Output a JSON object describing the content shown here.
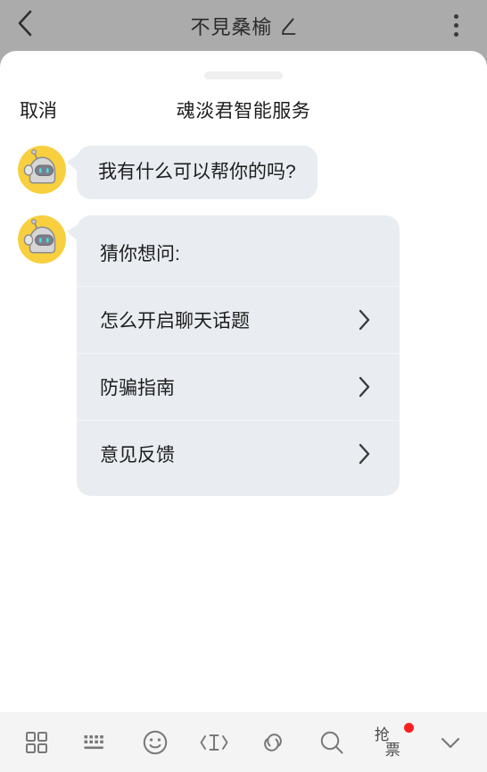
{
  "topbar": {
    "back_icon": "chevron-left-icon",
    "title": "不見桑榆",
    "edit_icon": "pencil-edit-icon",
    "more_icon": "more-vertical-icon"
  },
  "sheet": {
    "grabber": "drag-handle",
    "cancel_label": "取消",
    "title": "魂淡君智能服务"
  },
  "chat": {
    "messages": [
      {
        "avatar": "robot-avatar",
        "text": "我有什么可以帮你的吗?"
      }
    ],
    "card": {
      "avatar": "robot-avatar",
      "title": "猜你想问:",
      "items": [
        {
          "label": "怎么开启聊天话题",
          "chevron": "chevron-right-icon"
        },
        {
          "label": "防骗指南",
          "chevron": "chevron-right-icon"
        },
        {
          "label": "意见反馈",
          "chevron": "chevron-right-icon"
        }
      ]
    }
  },
  "toolbar": {
    "items": [
      {
        "icon": "grid-apps-icon",
        "label": ""
      },
      {
        "icon": "keyboard-icon",
        "label": ""
      },
      {
        "icon": "emoji-smiley-icon",
        "label": ""
      },
      {
        "icon": "text-cursor-icon",
        "label": ""
      },
      {
        "icon": "link-chain-icon",
        "label": ""
      },
      {
        "icon": "search-icon",
        "label": ""
      }
    ],
    "ticket": {
      "icon": "grab-ticket-icon",
      "char1": "抢",
      "char2": "票",
      "badge": "red-dot"
    },
    "collapse": {
      "icon": "chevron-down-icon"
    }
  },
  "colors": {
    "header_bg": "#ababab",
    "sheet_bg": "#ffffff",
    "bubble_bg": "#e9edf1",
    "toolbar_bg": "#f4f4f4",
    "text_primary": "#1d1d1d",
    "icon_grey": "#787878",
    "badge_red": "#fb2020",
    "avatar_ring": "#f7cf3f"
  }
}
